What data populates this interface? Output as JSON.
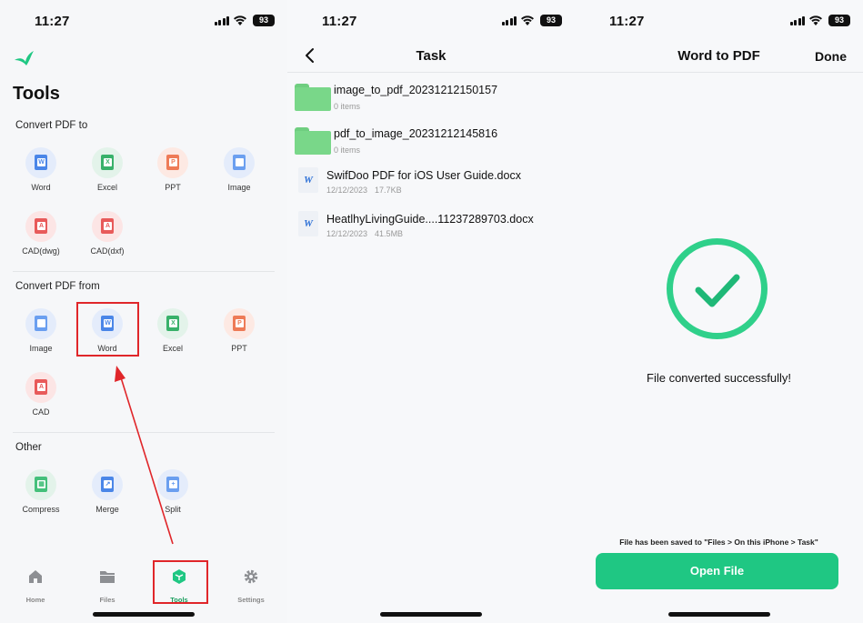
{
  "status_bar": {
    "time": "11:27",
    "battery": "93"
  },
  "tools_screen": {
    "title": "Tools",
    "sections": {
      "convert_to": {
        "title": "Convert PDF to",
        "items": [
          {
            "label": "Word",
            "icon": "word-icon",
            "letter": "W",
            "color": "#4a86e8"
          },
          {
            "label": "Excel",
            "icon": "excel-icon",
            "letter": "X",
            "color": "#38b16a"
          },
          {
            "label": "PPT",
            "icon": "ppt-icon",
            "letter": "P",
            "color": "#ee7b57"
          },
          {
            "label": "Image",
            "icon": "image-icon",
            "letter": "",
            "color": "#6b9ff0"
          },
          {
            "label": "CAD(dwg)",
            "icon": "cad-icon",
            "letter": "A",
            "color": "#e85a5a"
          },
          {
            "label": "CAD(dxf)",
            "icon": "cad-icon",
            "letter": "A",
            "color": "#e85a5a"
          }
        ]
      },
      "convert_from": {
        "title": "Convert PDF from",
        "items": [
          {
            "label": "Image",
            "icon": "image-icon",
            "letter": "",
            "color": "#6b9ff0"
          },
          {
            "label": "Word",
            "icon": "word-icon",
            "letter": "W",
            "color": "#4a86e8"
          },
          {
            "label": "Excel",
            "icon": "excel-icon",
            "letter": "X",
            "color": "#38b16a"
          },
          {
            "label": "PPT",
            "icon": "ppt-icon",
            "letter": "P",
            "color": "#ee7b57"
          },
          {
            "label": "CAD",
            "icon": "cad-icon",
            "letter": "A",
            "color": "#e85a5a"
          }
        ]
      },
      "other": {
        "title": "Other",
        "items": [
          {
            "label": "Compress",
            "icon": "compress-icon",
            "letter": "",
            "color": "#44c07a"
          },
          {
            "label": "Merge",
            "icon": "merge-icon",
            "letter": "",
            "color": "#4a86e8"
          },
          {
            "label": "Split",
            "icon": "split-icon",
            "letter": "",
            "color": "#6b9ff0"
          }
        ]
      }
    },
    "tabbar": [
      {
        "label": "Home",
        "icon": "home-icon"
      },
      {
        "label": "Files",
        "icon": "folder-icon"
      },
      {
        "label": "Tools",
        "icon": "tools-cube-icon",
        "active": true
      },
      {
        "label": "Settings",
        "icon": "gear-icon"
      }
    ]
  },
  "task_screen": {
    "title": "Task",
    "files": [
      {
        "type": "folder",
        "name": "image_to_pdf_20231212150157",
        "meta": [
          "0 items"
        ]
      },
      {
        "type": "folder",
        "name": "pdf_to_image_20231212145816",
        "meta": [
          "0 items"
        ]
      },
      {
        "type": "word",
        "name": "SwifDoo PDF for iOS User Guide.docx",
        "meta": [
          "12/12/2023",
          "17.7KB"
        ]
      },
      {
        "type": "word",
        "name": "Heatlhy​LivingGuide....11237289703.docx",
        "meta": [
          "12/12/2023",
          "41.5MB"
        ]
      }
    ]
  },
  "result_screen": {
    "title": "Word to PDF",
    "done_label": "Done",
    "success_message": "File converted successfully!",
    "saved_message": "File has been saved to \"Files > On this iPhone > Task\"",
    "open_button": "Open File",
    "accent_color": "#1fc783"
  }
}
